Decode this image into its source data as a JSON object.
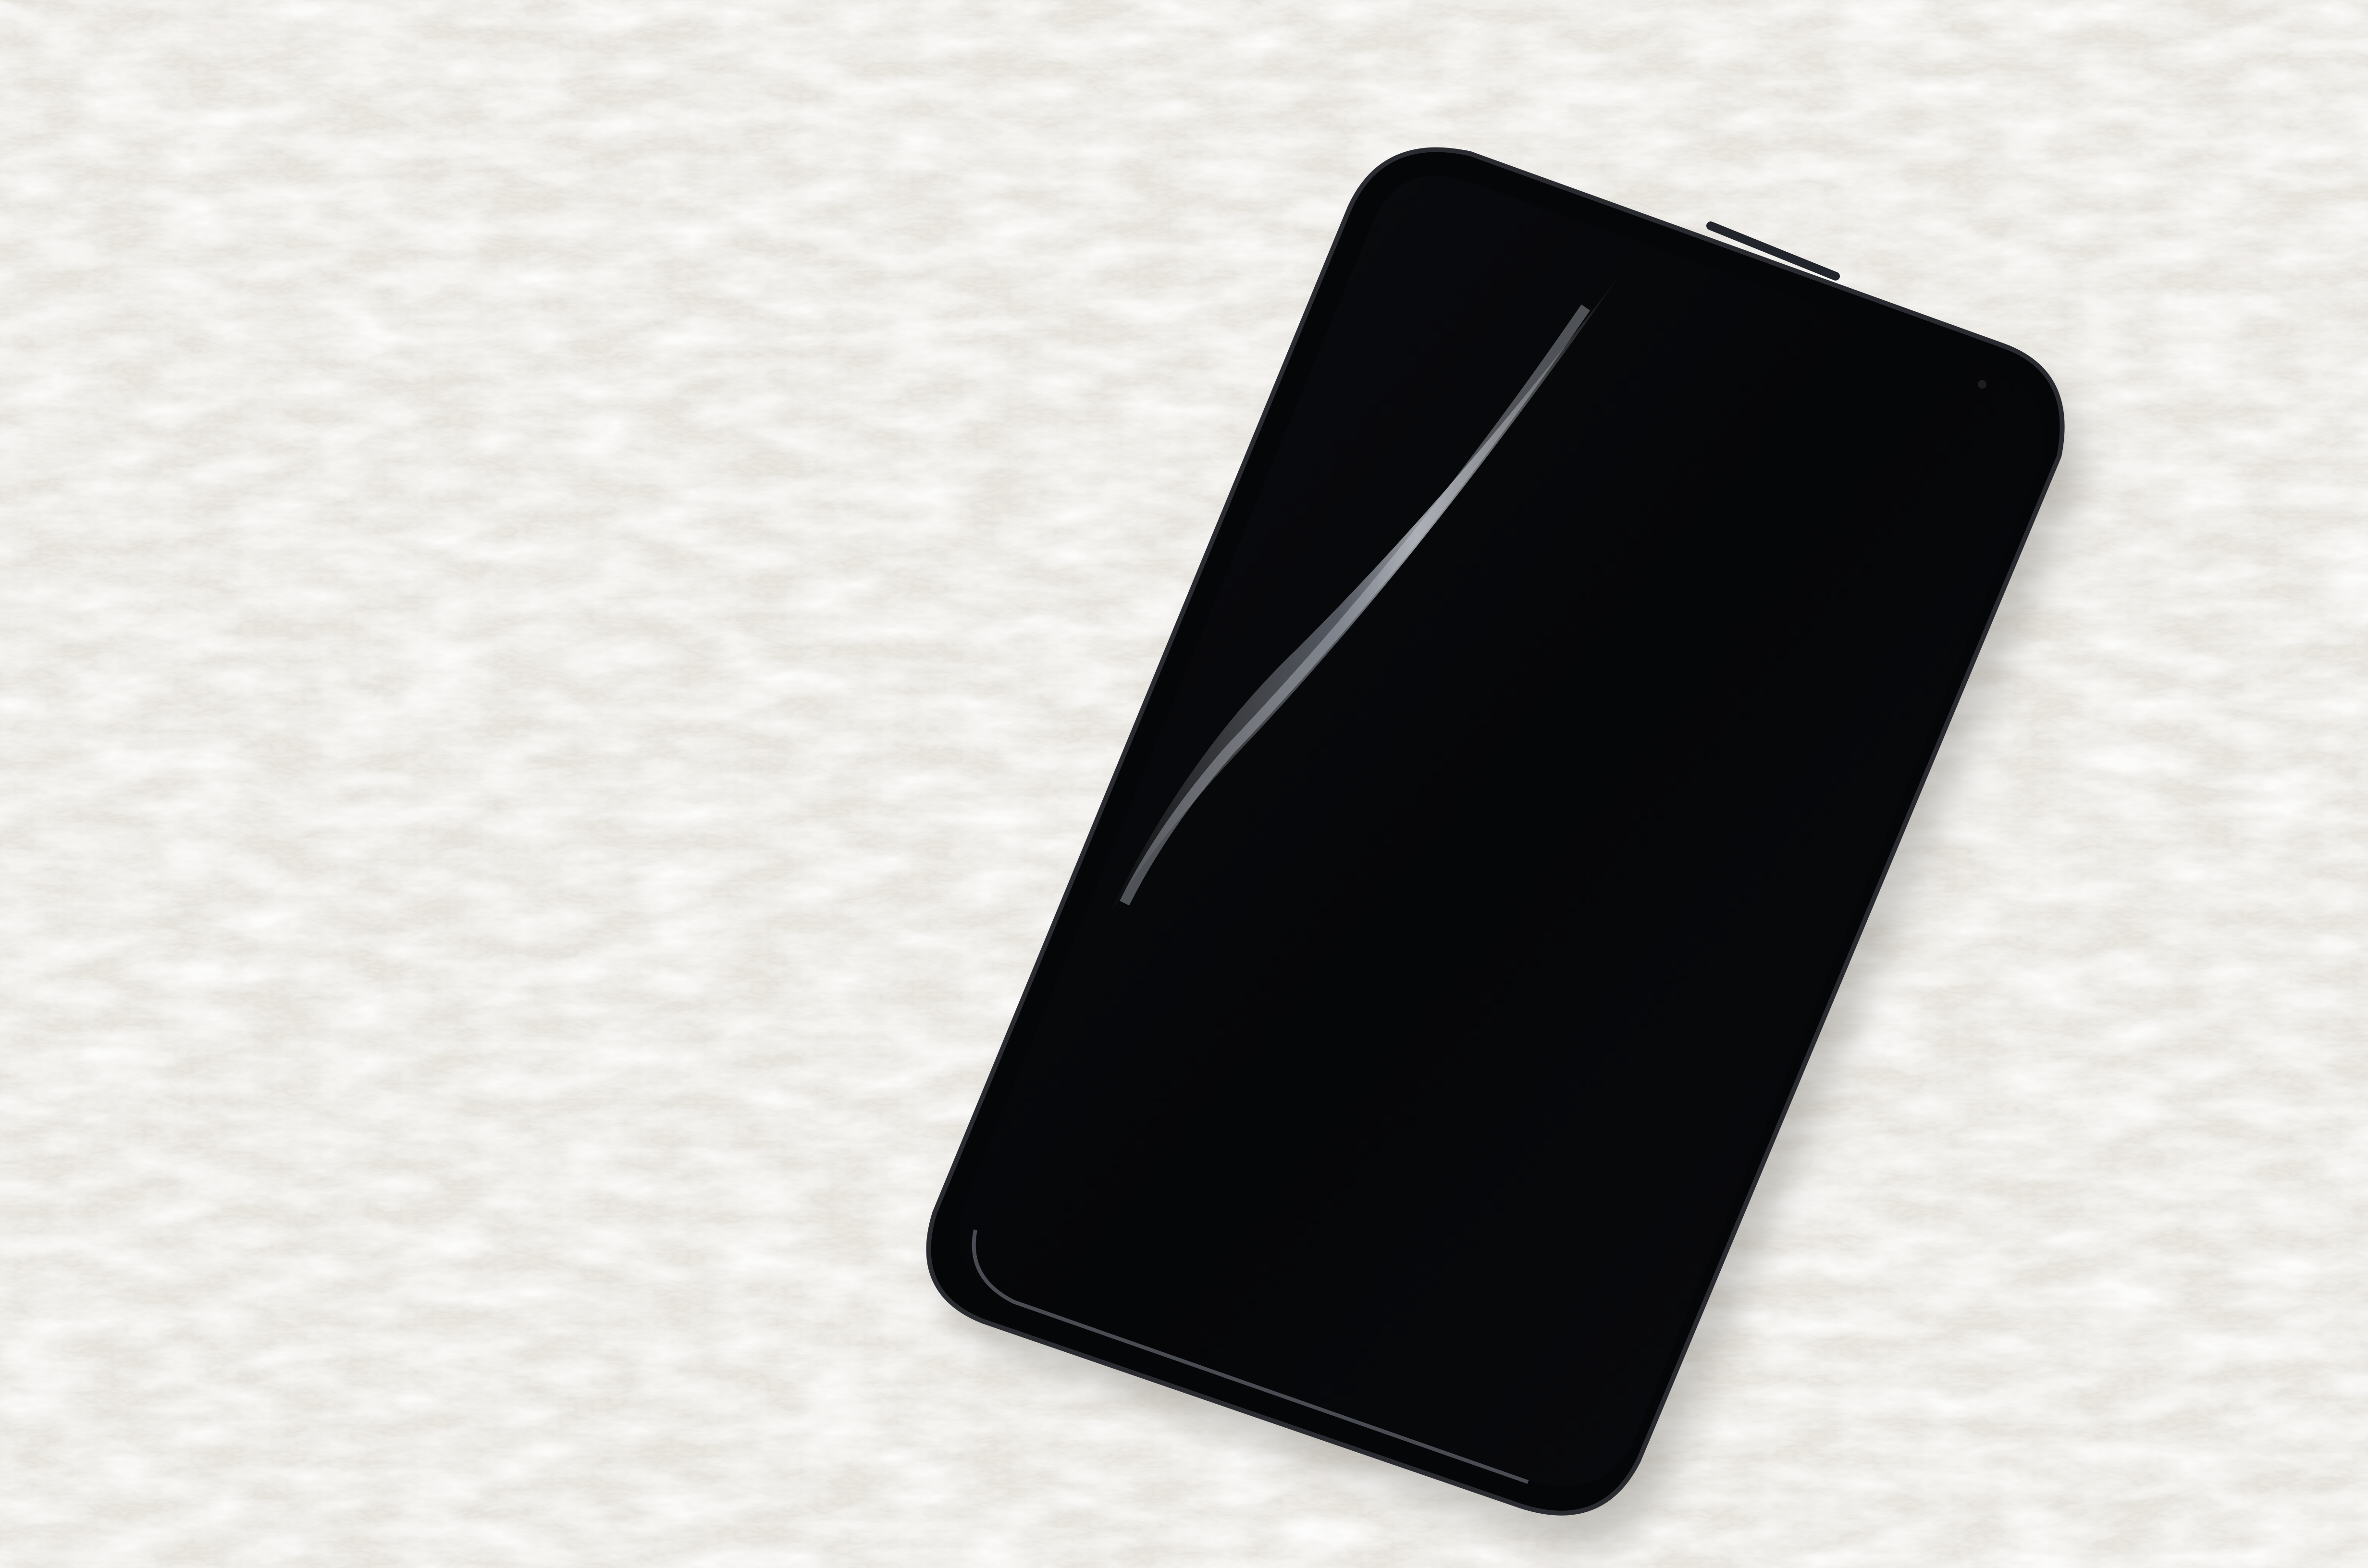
{
  "scene": {
    "subject": "smartphone-icon",
    "background": "white-fur-rug",
    "colors": {
      "rug_base": "#e9e6e0",
      "rug_highlight": "#ffffff",
      "rug_shadow": "#cfcac1",
      "phone_body": "#050608",
      "phone_screen": "#07080b",
      "phone_rim": "#2a2c31",
      "glare": "#6f7684"
    }
  }
}
